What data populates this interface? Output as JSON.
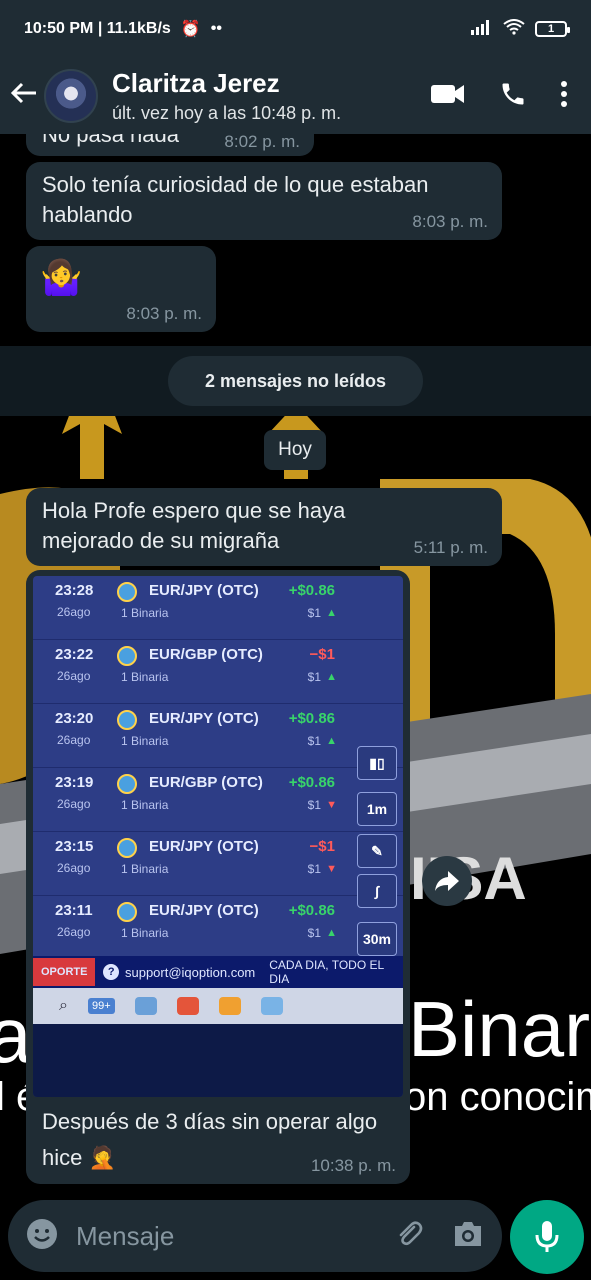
{
  "status_bar": {
    "left": "10:50 PM | 11.1kB/s",
    "battery": "1"
  },
  "header": {
    "contact_name": "Claritza Jerez",
    "last_seen": "últ. vez hoy a las 10:48 p. m."
  },
  "messages": [
    {
      "text": "No pasa nada",
      "time": "8:02 p. m."
    },
    {
      "text": "Solo tenía curiosidad de lo que estaban hablando",
      "time": "8:03 p. m."
    },
    {
      "text": "🤷‍♀️",
      "time": "8:03 p. m."
    },
    {
      "text": "Hola Profe espero que se haya mejorado de su migraña",
      "time": "5:11 p. m."
    },
    {
      "text": "Después de 3 días sin operar algo hice 🤦",
      "time": "10:38 p. m."
    }
  ],
  "unread_label": "2 mensajes no leídos",
  "date_chip": "Hoy",
  "image": {
    "trades": [
      {
        "time": "23:28",
        "date": "26ago",
        "pair": "EUR/JPY (OTC)",
        "kind": "1 Binaria",
        "result": "+$0.86",
        "amount": "$1",
        "direction": "up"
      },
      {
        "time": "23:22",
        "date": "26ago",
        "pair": "EUR/GBP (OTC)",
        "kind": "1 Binaria",
        "result": "−$1",
        "amount": "$1",
        "direction": "up"
      },
      {
        "time": "23:20",
        "date": "26ago",
        "pair": "EUR/JPY (OTC)",
        "kind": "1 Binaria",
        "result": "+$0.86",
        "amount": "$1",
        "direction": "up"
      },
      {
        "time": "23:19",
        "date": "26ago",
        "pair": "EUR/GBP (OTC)",
        "kind": "1 Binaria",
        "result": "+$0.86",
        "amount": "$1",
        "direction": "down"
      },
      {
        "time": "23:15",
        "date": "26ago",
        "pair": "EUR/JPY (OTC)",
        "kind": "1 Binaria",
        "result": "−$1",
        "amount": "$1",
        "direction": "down"
      },
      {
        "time": "23:11",
        "date": "26ago",
        "pair": "EUR/JPY (OTC)",
        "kind": "1 Binaria",
        "result": "+$0.86",
        "amount": "$1",
        "direction": "up"
      }
    ],
    "side_1m": "1m",
    "side_30m": "30m",
    "support_left": "OPORTE",
    "support_email": "support@iqoption.com",
    "support_right": "CADA DIA, TODO EL DIA",
    "taskbar_badge": "99+"
  },
  "wallpaper_text": {
    "line1_left": "a",
    "line1_right": "Binar",
    "line2_left": "l é",
    "line2_right": "on conocimie",
    "logo_letter": "IISA"
  },
  "composer": {
    "placeholder": "Mensaje"
  },
  "colors": {
    "profit": "#38d46a",
    "loss": "#ff5a5a",
    "accent": "#00a884"
  }
}
